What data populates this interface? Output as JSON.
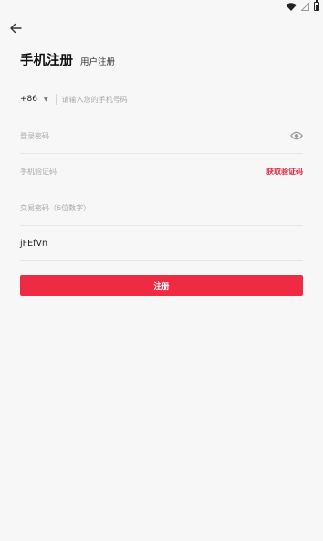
{
  "header": {
    "title": "手机注册",
    "alt_tab": "用户注册"
  },
  "form": {
    "country_code": "+86",
    "phone_placeholder": "请输入您的手机号码",
    "password_placeholder": "登录密码",
    "sms_code_placeholder": "手机验证码",
    "get_code_label": "获取验证码",
    "trade_password_placeholder": "交易密码（6位数字）",
    "captcha_value": "jFEfVn",
    "submit_label": "注册"
  },
  "icons": {
    "back": "arrow-left-icon",
    "visibility": "eye-icon",
    "dropdown": "caret-down-icon",
    "wifi": "wifi-icon",
    "battery": "battery-icon"
  },
  "colors": {
    "accent": "#ef2b43",
    "link": "#e2233f",
    "background": "#f7f7f7"
  }
}
